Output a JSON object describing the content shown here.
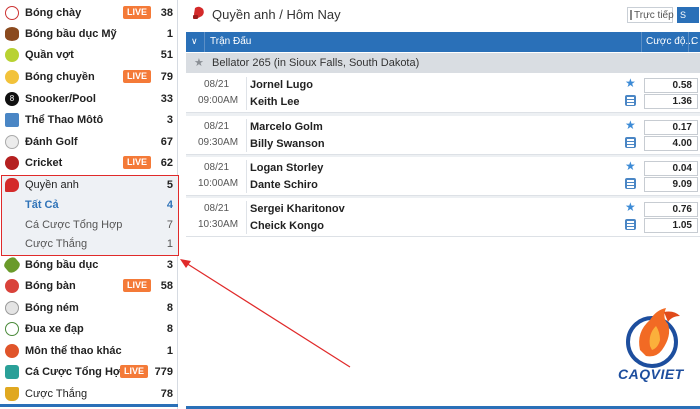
{
  "sidebar": {
    "items": [
      {
        "label": "Bóng chày",
        "count": "38",
        "live": "LIVE"
      },
      {
        "label": "Bóng bầu dục Mỹ",
        "count": "1",
        "live": null
      },
      {
        "label": "Quần vợt",
        "count": "51",
        "live": null
      },
      {
        "label": "Bóng chuyền",
        "count": "79",
        "live": "LIVE"
      },
      {
        "label": "Snooker/Pool",
        "count": "33",
        "live": null
      },
      {
        "label": "Thể Thao Môtô",
        "count": "3",
        "live": null
      },
      {
        "label": "Đánh Golf",
        "count": "67",
        "live": null
      },
      {
        "label": "Cricket",
        "count": "62",
        "live": "LIVE"
      },
      {
        "label": "Quyền anh",
        "count": "5",
        "live": null
      },
      {
        "label": "Bóng bầu dục",
        "count": "3",
        "live": null
      },
      {
        "label": "Bóng bàn",
        "count": "58",
        "live": "LIVE"
      },
      {
        "label": "Bóng ném",
        "count": "8",
        "live": null
      },
      {
        "label": "Đua xe đạp",
        "count": "8",
        "live": null
      },
      {
        "label": "Môn thể thao khác",
        "count": "1",
        "live": null
      },
      {
        "label": "Cá Cược Tổng Hợp",
        "count": "779",
        "live": "LIVE"
      },
      {
        "label": "Cược Thắng",
        "count": "78",
        "live": null
      }
    ],
    "subitems": [
      {
        "label": "Tất Cả",
        "count": "4"
      },
      {
        "label": "Cá Cược Tổng Hợp",
        "count": "7"
      },
      {
        "label": "Cược Thắng",
        "count": "1"
      }
    ]
  },
  "header": {
    "breadcrumb": "Quyền anh / Hôm Nay",
    "live_toggle": "Trực tiếp",
    "view_button": "S"
  },
  "table": {
    "col_match": "Trận Đấu",
    "col_odds": "Cược độ...",
    "col_extra": "C",
    "league": "Bellator 265 (in Sioux Falls, South Dakota)"
  },
  "matches": [
    {
      "date": "08/21",
      "time": "09:00AM",
      "home": "Jornel Lugo",
      "away": "Keith Lee",
      "odd1": "0.58",
      "odd2": "1.36"
    },
    {
      "date": "08/21",
      "time": "09:30AM",
      "home": "Marcelo Golm",
      "away": "Billy Swanson",
      "odd1": "0.17",
      "odd2": "4.00"
    },
    {
      "date": "08/21",
      "time": "10:00AM",
      "home": "Logan Storley",
      "away": "Dante Schiro",
      "odd1": "0.04",
      "odd2": "9.09"
    },
    {
      "date": "08/21",
      "time": "10:30AM",
      "home": "Sergei Kharitonov",
      "away": "Cheick Kongo",
      "odd1": "0.76",
      "odd2": "1.05"
    }
  ],
  "logo": {
    "text": "CAQVIET"
  },
  "colors": {
    "accent": "#2a70b8",
    "live": "#f47a38",
    "highlight": "#e02a2a"
  }
}
